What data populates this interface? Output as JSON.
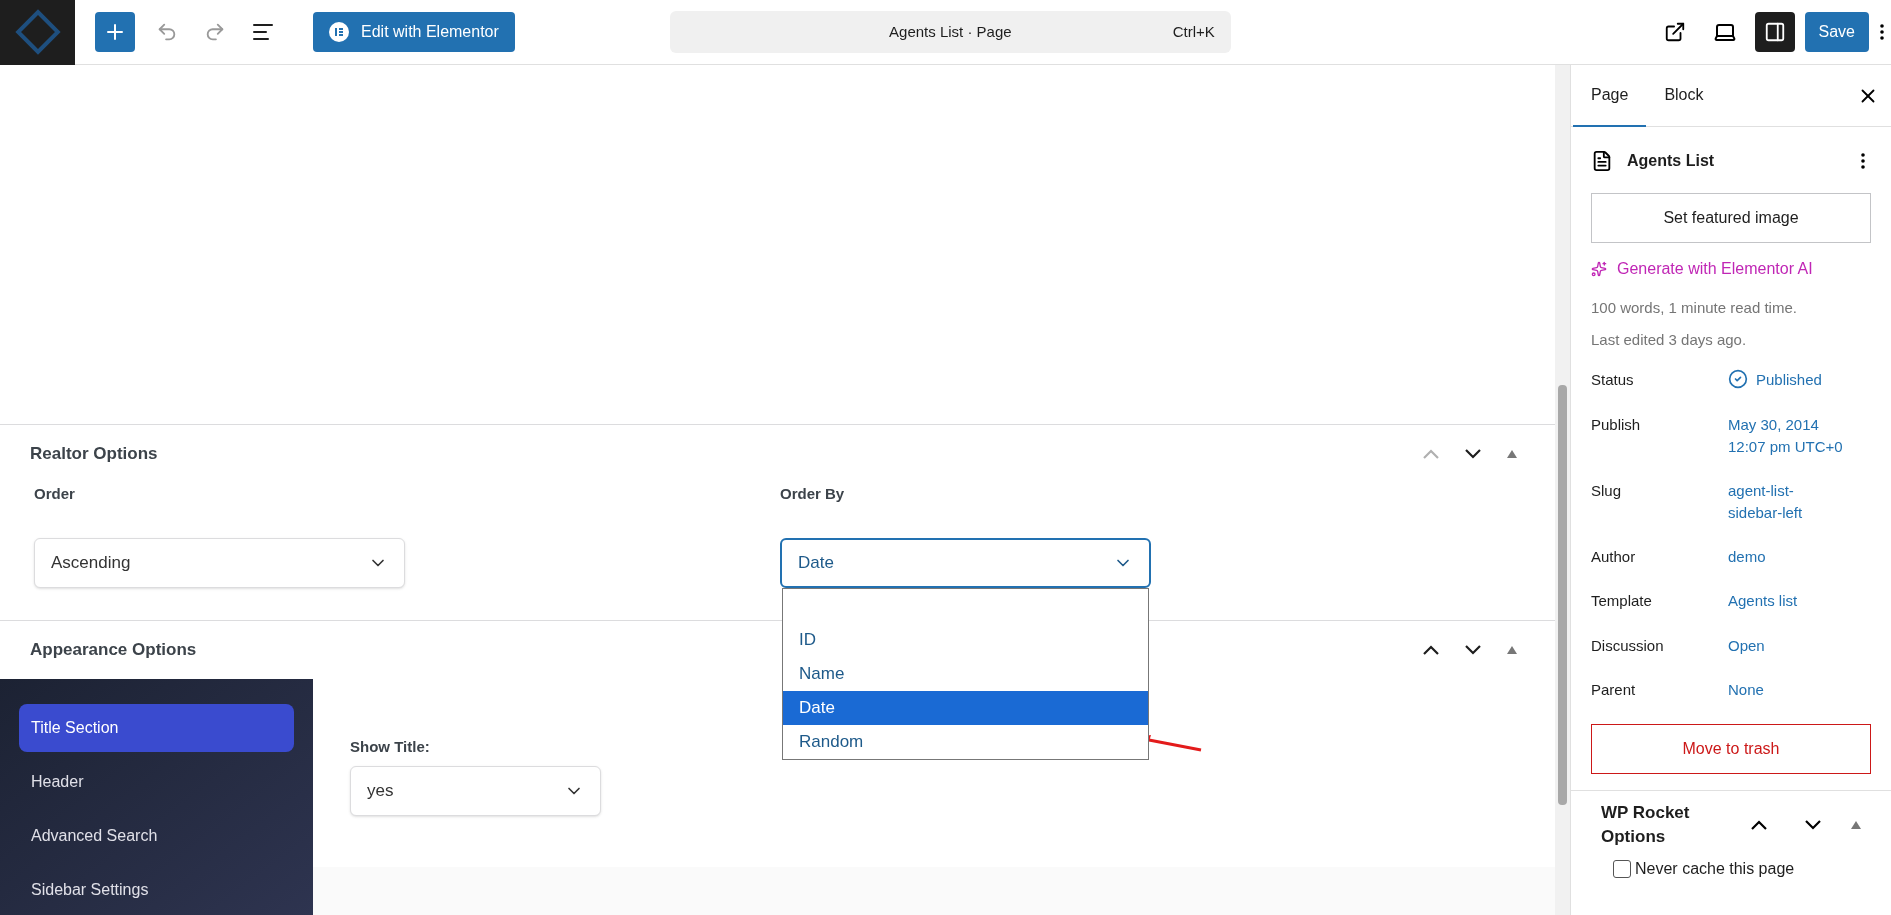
{
  "toolbar": {
    "edit_button": "Edit with Elementor",
    "command": {
      "title": "Agents List · Page",
      "shortcut": "Ctrl+K"
    },
    "save": "Save"
  },
  "sections": [
    {
      "title": "Realtor Options",
      "up_disabled": true,
      "fields": [
        {
          "label": "Order",
          "value": "Ascending",
          "open": false
        },
        {
          "label": "Order By",
          "value": "Date",
          "open": true,
          "options": [
            {
              "label": "ID",
              "selected": false
            },
            {
              "label": "Name",
              "selected": false
            },
            {
              "label": "Date",
              "selected": true
            },
            {
              "label": "Random",
              "selected": false
            }
          ]
        }
      ]
    },
    {
      "title": "Appearance Options",
      "up_disabled": false,
      "nav": [
        {
          "label": "Title Section",
          "selected": true
        },
        {
          "label": "Header",
          "selected": false
        },
        {
          "label": "Advanced Search",
          "selected": false
        },
        {
          "label": "Sidebar Settings",
          "selected": false
        }
      ],
      "fields": [
        {
          "label": "Show Title:",
          "value": "yes",
          "open": false
        }
      ]
    }
  ],
  "sidebar": {
    "tabs": [
      {
        "label": "Page",
        "selected": true
      },
      {
        "label": "Block",
        "selected": false
      }
    ],
    "title": "Agents List",
    "featured_button": "Set featured image",
    "ai_link": "Generate with Elementor AI",
    "stats": [
      "100 words, 1 minute read time.",
      "Last edited 3 days ago."
    ],
    "meta": [
      {
        "label": "Status",
        "value": [
          "Published"
        ],
        "kind": "status"
      },
      {
        "label": "Publish",
        "value": [
          "May 30, 2014",
          "12:07 pm UTC+0"
        ],
        "kind": "text"
      },
      {
        "label": "Slug",
        "value": [
          "agent-list-",
          "sidebar-left"
        ],
        "kind": "text"
      },
      {
        "label": "Author",
        "value": [
          "demo"
        ],
        "kind": "text"
      },
      {
        "label": "Template",
        "value": [
          "Agents list"
        ],
        "kind": "text"
      },
      {
        "label": "Discussion",
        "value": [
          "Open"
        ],
        "kind": "text"
      },
      {
        "label": "Parent",
        "value": [
          "None"
        ],
        "kind": "text"
      }
    ],
    "trash_button": "Move to trash",
    "rocket": {
      "title": "WP Rocket Options",
      "checkbox": {
        "label": "Never cache this page",
        "checked": false
      }
    }
  }
}
